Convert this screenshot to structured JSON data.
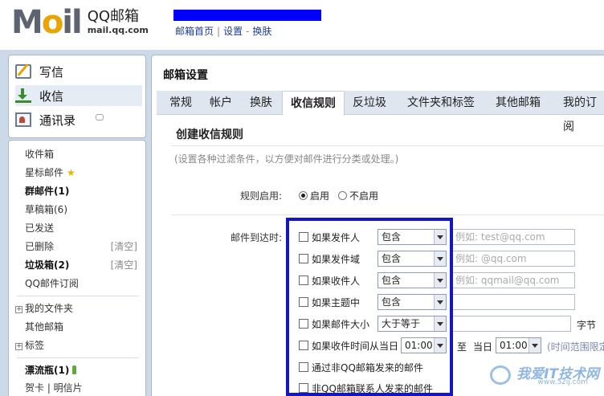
{
  "header": {
    "logo_text": "Mail",
    "brand_cn": "QQ邮箱",
    "domain": "mail.qq.com",
    "links": [
      "邮箱首页",
      "设置",
      "换肤"
    ]
  },
  "sidebar": {
    "top_items": [
      {
        "label": "写信",
        "icon": "pencil-icon"
      },
      {
        "label": "收信",
        "icon": "download-icon"
      },
      {
        "label": "通讯录",
        "icon": "contacts-icon"
      }
    ],
    "folders": {
      "inbox": "收件箱",
      "starred": "星标邮件",
      "group": "群邮件(1)",
      "drafts": "草稿箱(6)",
      "sent": "已发送",
      "deleted": "已删除",
      "deleted_clear": "[清空]",
      "spam": "垃圾箱(2)",
      "spam_clear": "[清空]",
      "subscription": "QQ邮件订阅",
      "my_folders": "我的文件夹",
      "other_mail": "其他邮箱",
      "tags": "标签",
      "bottle": "漂流瓶(1)",
      "cards": "贺卡 | 明信片"
    }
  },
  "main": {
    "title": "邮箱设置",
    "tabs": [
      "常规",
      "帐户",
      "换肤",
      "收信规则",
      "反垃圾",
      "文件夹和标签",
      "其他邮箱",
      "我的订阅"
    ],
    "active_tab": "收信规则",
    "section_title": "创建收信规则",
    "hint": "(设置各种过滤条件，以方便对邮件进行分类或处理。)",
    "enable_label": "规则启用:",
    "enable_on": "启用",
    "enable_off": "不启用",
    "arrive_label": "邮件到达时:",
    "rules": {
      "sender": {
        "label": "如果发件人",
        "op": "包含",
        "placeholder": "例如: test@qq.com"
      },
      "sender_domain": {
        "label": "如果发件域",
        "op": "包含",
        "placeholder": "例如: @qq.com"
      },
      "recipient": {
        "label": "如果收件人",
        "op": "包含",
        "placeholder": "例如: qqmail@qq.com"
      },
      "subject": {
        "label": "如果主题中",
        "op": "包含",
        "placeholder": ""
      },
      "size": {
        "label": "如果邮件大小",
        "op": "大于等于",
        "unit": "字节"
      },
      "time": {
        "label": "如果收件时间从当日",
        "from": "01:00",
        "to_label": "至",
        "day_label": "当日",
        "to": "01:00",
        "range_hint": "(时间范围限定"
      },
      "non_qq": {
        "label": "通过非QQ邮箱发来的邮件"
      },
      "non_contact": {
        "label": "非QQ邮箱联系人发来的邮件"
      }
    }
  },
  "watermark": {
    "text": "我爱IT技术网",
    "url": "www.52ij.com"
  },
  "colors": {
    "highlight_frame": "#1515c8",
    "redaction_bar": "#0000ff",
    "page_bg": "#cbd9e9"
  }
}
